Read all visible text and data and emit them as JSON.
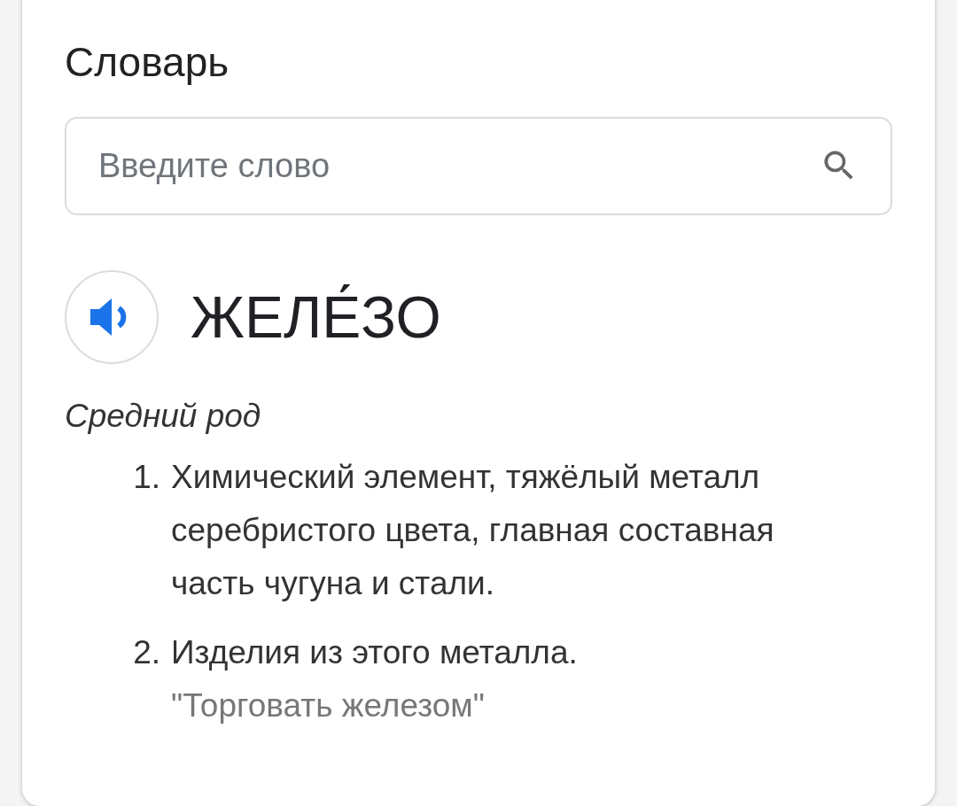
{
  "card": {
    "title": "Словарь",
    "search": {
      "placeholder": "Введите слово"
    },
    "entry": {
      "word": "ЖЕЛЕ́ЗО",
      "gender": "Средний род",
      "definitions": [
        {
          "number": "1.",
          "text": "Химический элемент, тяжёлый металл серебристого цвета, главная составная часть чугуна и стали."
        },
        {
          "number": "2.",
          "text": "Изделия из этого металла.",
          "example": "\"Торговать железом\""
        }
      ]
    }
  }
}
